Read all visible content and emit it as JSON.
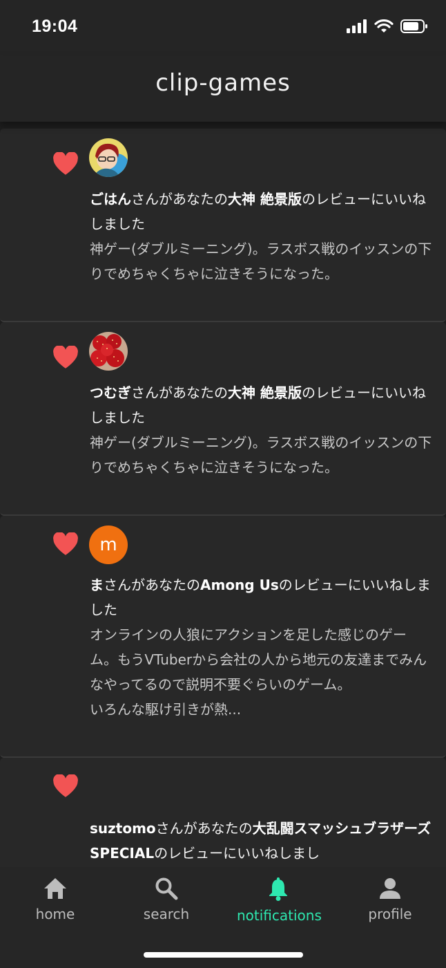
{
  "status_bar": {
    "time": "19:04"
  },
  "header": {
    "title": "clip-games"
  },
  "notifications": [
    {
      "user": "ごはん",
      "middle": "さんがあなたの",
      "game": "大神 絶景版",
      "suffix": "のレビューにいいねしました",
      "review": "神ゲー(ダブルミーニング)。ラスボス戦のイッスンの下りでめちゃくちゃに泣きそうになった。",
      "avatar": "anime-character-avatar"
    },
    {
      "user": "つむぎ",
      "middle": "さんがあなたの",
      "game": "大神 絶景版",
      "suffix": "のレビューにいいねしました",
      "review": "神ゲー(ダブルミーニング)。ラスボス戦のイッスンの下りでめちゃくちゃに泣きそうになった。",
      "avatar": "strawberry-avatar"
    },
    {
      "user": "ま",
      "middle": "さんがあなたの",
      "game": "Among Us",
      "suffix": "のレビューにいいねしました",
      "review": "オンラインの人狼にアクションを足した感じのゲーム。もうVTuberから会社の人から地元の友達までみんなやってるので説明不要ぐらいのゲーム。\nいろんな駆け引きが熱...",
      "avatar_letter": "m",
      "avatar_color": "#f07010"
    },
    {
      "user": "suztomo",
      "middle": "さんがあなたの",
      "game": "大乱闘スマッシュブラザーズ SPECIAL",
      "suffix": "のレビューにいいねしまし",
      "review": ""
    }
  ],
  "tabs": [
    {
      "label": "home",
      "icon": "home-icon",
      "active": false
    },
    {
      "label": "search",
      "icon": "search-icon",
      "active": false
    },
    {
      "label": "notifications",
      "icon": "bell-icon",
      "active": true
    },
    {
      "label": "profile",
      "icon": "person-icon",
      "active": false
    }
  ],
  "colors": {
    "heart": "#f25454",
    "accent": "#2ee8b0",
    "background": "#262626"
  }
}
